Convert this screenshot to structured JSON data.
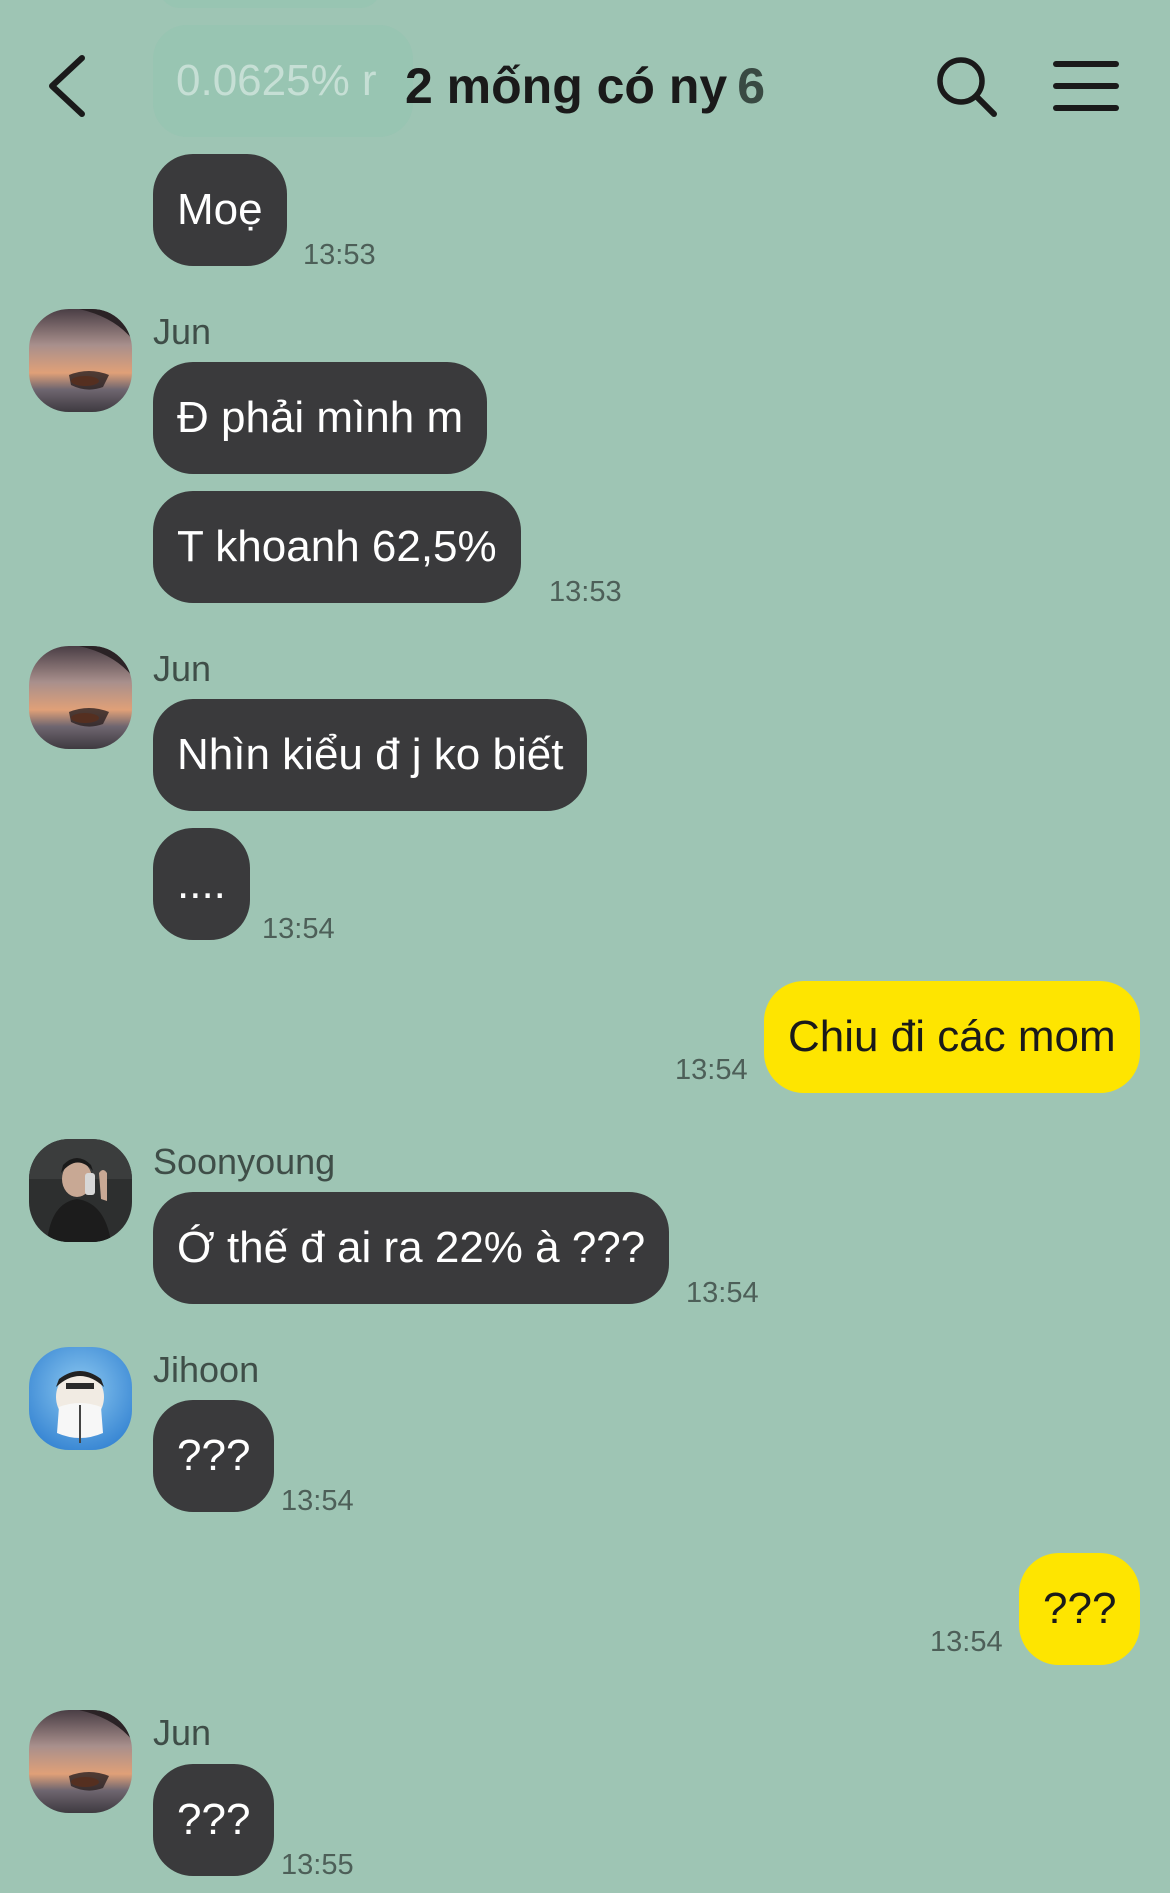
{
  "header": {
    "title": "2 mống có ny",
    "member_count": "6",
    "back_icon": "chevron-left-icon",
    "search_icon": "search-icon",
    "menu_icon": "hamburger-menu-icon"
  },
  "ghost_message": {
    "text": "0.0625% r"
  },
  "messages": [
    {
      "sender": "",
      "text": "Moẹ",
      "time": "13:53",
      "mine": false
    },
    {
      "sender": "Jun",
      "text": "Đ phải mình m",
      "time": "",
      "mine": false
    },
    {
      "sender": "",
      "text": "T khoanh 62,5%",
      "time": "13:53",
      "mine": false
    },
    {
      "sender": "Jun",
      "text": "Nhìn kiểu đ j ko biết",
      "time": "",
      "mine": false
    },
    {
      "sender": "",
      "text": "....",
      "time": "13:54",
      "mine": false
    },
    {
      "sender": "",
      "text": "Chiu đi các mom",
      "time": "13:54",
      "mine": true
    },
    {
      "sender": "Soonyoung",
      "text": "Ớ thế đ ai ra 22% à ???",
      "time": "13:54",
      "mine": false
    },
    {
      "sender": "Jihoon",
      "text": "???",
      "time": "13:54",
      "mine": false
    },
    {
      "sender": "",
      "text": "???",
      "time": "13:54",
      "mine": true
    },
    {
      "sender": "Jun",
      "text": "???",
      "time": "13:55",
      "mine": false
    }
  ],
  "colors": {
    "background": "#9ec5b4",
    "their_bubble": "#3a3a3c",
    "my_bubble": "#fee500"
  }
}
